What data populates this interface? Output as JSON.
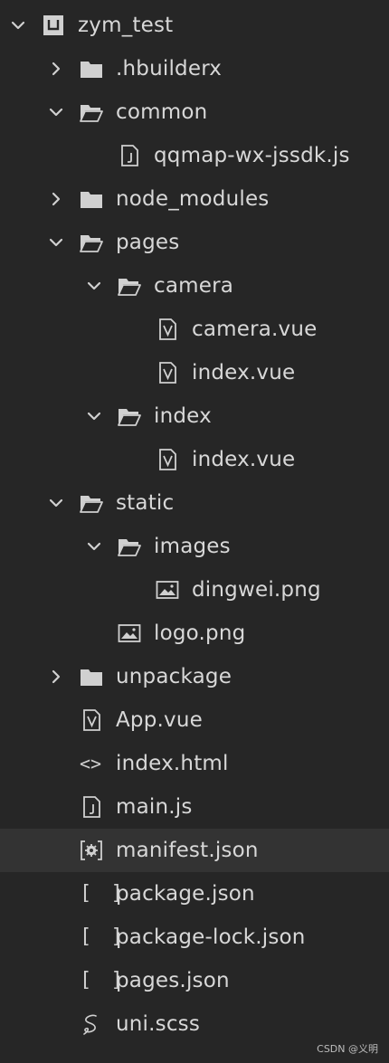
{
  "tree": [
    {
      "label": "zym_test",
      "level": 0,
      "type": "project",
      "expanded": true
    },
    {
      "label": ".hbuilderx",
      "level": 1,
      "type": "folder",
      "expanded": false
    },
    {
      "label": "common",
      "level": 1,
      "type": "folder",
      "expanded": true
    },
    {
      "label": "qqmap-wx-jssdk.js",
      "level": 2,
      "type": "js"
    },
    {
      "label": "node_modules",
      "level": 1,
      "type": "folder",
      "expanded": false
    },
    {
      "label": "pages",
      "level": 1,
      "type": "folder",
      "expanded": true
    },
    {
      "label": "camera",
      "level": 2,
      "type": "folder",
      "expanded": true
    },
    {
      "label": "camera.vue",
      "level": 3,
      "type": "vue"
    },
    {
      "label": "index.vue",
      "level": 3,
      "type": "vue"
    },
    {
      "label": "index",
      "level": 2,
      "type": "folder",
      "expanded": true
    },
    {
      "label": "index.vue",
      "level": 3,
      "type": "vue"
    },
    {
      "label": "static",
      "level": 1,
      "type": "folder",
      "expanded": true
    },
    {
      "label": "images",
      "level": 2,
      "type": "folder",
      "expanded": true
    },
    {
      "label": "dingwei.png",
      "level": 3,
      "type": "image"
    },
    {
      "label": "logo.png",
      "level": 2,
      "type": "image"
    },
    {
      "label": "unpackage",
      "level": 1,
      "type": "folder",
      "expanded": false
    },
    {
      "label": "App.vue",
      "level": 1,
      "type": "vue"
    },
    {
      "label": "index.html",
      "level": 1,
      "type": "html"
    },
    {
      "label": "main.js",
      "level": 1,
      "type": "js"
    },
    {
      "label": "manifest.json",
      "level": 1,
      "type": "manifest",
      "selected": true
    },
    {
      "label": "package.json",
      "level": 1,
      "type": "json"
    },
    {
      "label": "package-lock.json",
      "level": 1,
      "type": "json"
    },
    {
      "label": "pages.json",
      "level": 1,
      "type": "json"
    },
    {
      "label": "uni.scss",
      "level": 1,
      "type": "scss"
    }
  ],
  "watermark": "CSDN @义明",
  "colors": {
    "background": "#262626",
    "selected_row": "#333333",
    "text": "#d8d8d8",
    "icon": "#d0d0d0"
  }
}
